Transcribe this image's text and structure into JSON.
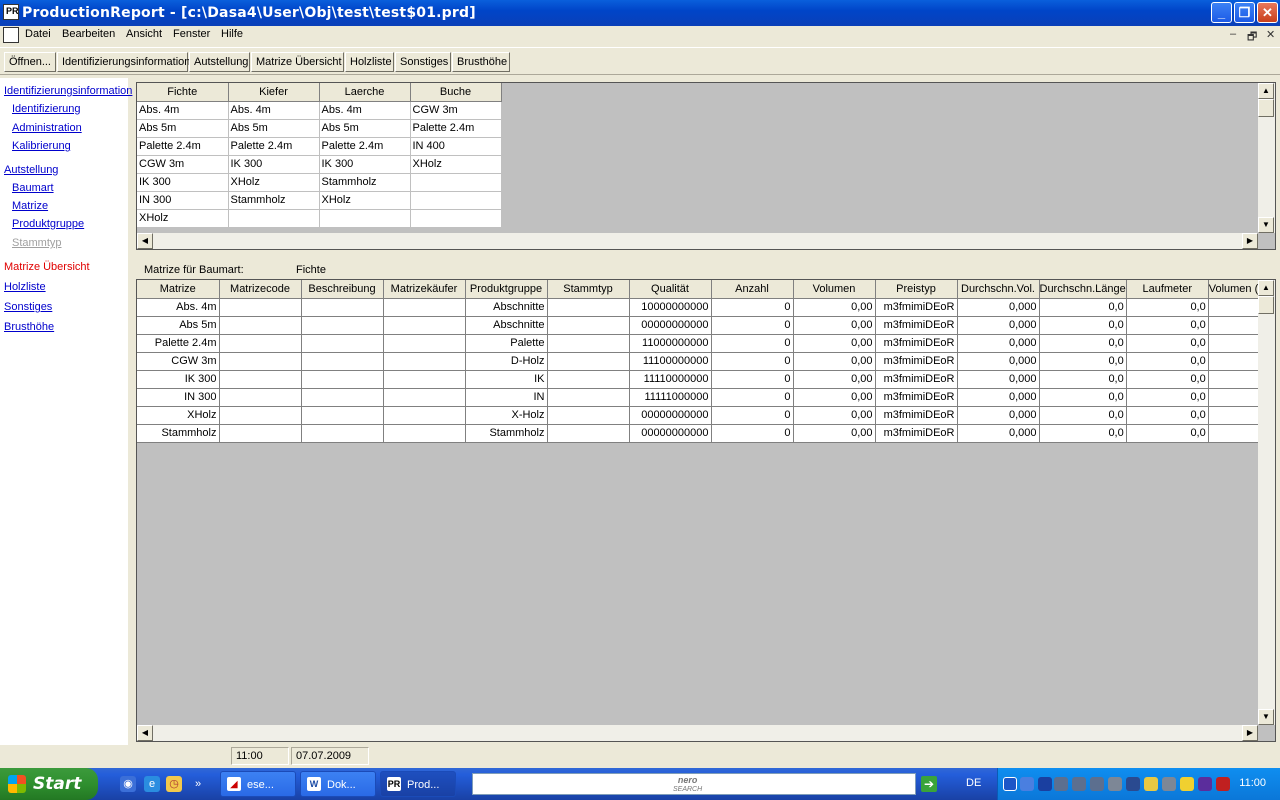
{
  "window": {
    "title": "ProductionReport - [c:\\Dasa4\\User\\Obj\\test\\test$01.prd]",
    "icon_text": "PR",
    "minimize": "_",
    "restore": "❐",
    "close": "✕"
  },
  "menubar": {
    "items": [
      "Datei",
      "Bearbeiten",
      "Ansicht",
      "Fenster",
      "Hilfe"
    ],
    "mdi_min": "–",
    "mdi_restore": "🗗",
    "mdi_close": "✕"
  },
  "toolbar": {
    "buttons": [
      "Öffnen...",
      "Identifizierungsinformation",
      "Autstellung",
      "Matrize Übersicht",
      "Holzliste",
      "Sonstiges",
      "Brusthöhe"
    ]
  },
  "nav": {
    "identifizierungsinformation": "Identifizierungsinformation",
    "identifizierung": "Identifizierung",
    "administration": "Administration",
    "kalibrierung": "Kalibrierung",
    "autstellung": "Autstellung",
    "baumart": "Baumart",
    "matrize": "Matrize",
    "produktgruppe": "Produktgruppe",
    "stammtyp": "Stammtyp",
    "matrize_uebersicht": "Matrize Übersicht",
    "holzliste": "Holzliste",
    "sonstiges": "Sonstiges",
    "brusthoehe": "Brusthöhe"
  },
  "species_grid": {
    "headers": [
      "Fichte",
      "Kiefer",
      "Laerche",
      "Buche"
    ],
    "rows": [
      [
        "Abs. 4m",
        "Abs. 4m",
        "Abs. 4m",
        "CGW 3m"
      ],
      [
        "Abs 5m",
        "Abs 5m",
        "Abs 5m",
        "Palette 2.4m"
      ],
      [
        "Palette 2.4m",
        "Palette 2.4m",
        "Palette 2.4m",
        "IN 400"
      ],
      [
        "CGW 3m",
        "IK 300",
        "IK 300",
        "XHolz"
      ],
      [
        "IK 300",
        "XHolz",
        "Stammholz",
        ""
      ],
      [
        "IN 300",
        "Stammholz",
        "XHolz",
        ""
      ],
      [
        "XHolz",
        "",
        "",
        ""
      ]
    ]
  },
  "matrix_label": {
    "caption": "Matrize für Baumart:",
    "value": "Fichte"
  },
  "matrix_grid": {
    "headers": [
      "Matrize",
      "Matrizecode",
      "Beschreibung",
      "Matrizekäufer",
      "Produktgruppe",
      "Stammtyp",
      "Qualität",
      "Anzahl",
      "Volumen",
      "Preistyp",
      "Durchschn.Vol.",
      "Durchschn.Länge",
      "Laufmeter",
      "Volumen (m"
    ],
    "rows": [
      [
        "Abs. 4m",
        "",
        "",
        "",
        "Abschnitte",
        "",
        "10000000000",
        "0",
        "0,00",
        "m3fmimiDEoR",
        "0,000",
        "0,0",
        "0,0",
        ""
      ],
      [
        "Abs 5m",
        "",
        "",
        "",
        "Abschnitte",
        "",
        "00000000000",
        "0",
        "0,00",
        "m3fmimiDEoR",
        "0,000",
        "0,0",
        "0,0",
        ""
      ],
      [
        "Palette 2.4m",
        "",
        "",
        "",
        "Palette",
        "",
        "11000000000",
        "0",
        "0,00",
        "m3fmimiDEoR",
        "0,000",
        "0,0",
        "0,0",
        ""
      ],
      [
        "CGW 3m",
        "",
        "",
        "",
        "D-Holz",
        "",
        "11100000000",
        "0",
        "0,00",
        "m3fmimiDEoR",
        "0,000",
        "0,0",
        "0,0",
        ""
      ],
      [
        "IK 300",
        "",
        "",
        "",
        "IK",
        "",
        "11110000000",
        "0",
        "0,00",
        "m3fmimiDEoR",
        "0,000",
        "0,0",
        "0,0",
        ""
      ],
      [
        "IN 300",
        "",
        "",
        "",
        "IN",
        "",
        "11111000000",
        "0",
        "0,00",
        "m3fmimiDEoR",
        "0,000",
        "0,0",
        "0,0",
        ""
      ],
      [
        "XHolz",
        "",
        "",
        "",
        "X-Holz",
        "",
        "00000000000",
        "0",
        "0,00",
        "m3fmimiDEoR",
        "0,000",
        "0,0",
        "0,0",
        ""
      ],
      [
        "Stammholz",
        "",
        "",
        "",
        "Stammholz",
        "",
        "00000000000",
        "0",
        "0,00",
        "m3fmimiDEoR",
        "0,000",
        "0,0",
        "0,0",
        ""
      ]
    ]
  },
  "status": {
    "time": "11:00",
    "date": "07.07.2009"
  },
  "taskbar": {
    "start": "Start",
    "tasks": [
      "ese...",
      "Dok...",
      "Prod..."
    ],
    "search_brand_top": "nero",
    "search_brand_bottom": "SEARCH",
    "go": "➔",
    "language": "DE",
    "clock": "11:00"
  }
}
